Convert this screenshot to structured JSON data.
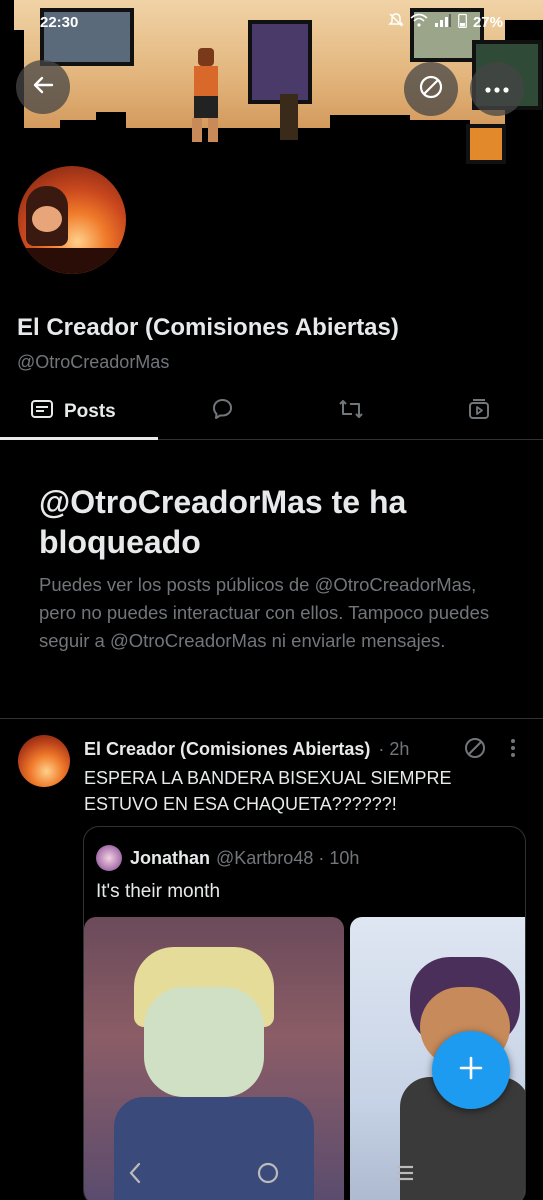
{
  "status_bar": {
    "time": "22:30",
    "battery": "27%"
  },
  "profile": {
    "display_name": "El Creador (Comisiones Abiertas)",
    "handle": "@OtroCreadorMas"
  },
  "tabs": [
    {
      "label": "Posts",
      "icon": "posts-icon",
      "active": true
    },
    {
      "label": "",
      "icon": "replies-icon"
    },
    {
      "label": "",
      "icon": "repost-icon"
    },
    {
      "label": "",
      "icon": "media-icon"
    }
  ],
  "blocked_notice": {
    "title": "@OtroCreadorMas te ha bloqueado",
    "description": "Puedes ver los posts públicos de @OtroCreadorMas, pero no puedes interactuar con ellos. Tampoco puedes seguir a @OtroCreadorMas ni enviarle mensajes."
  },
  "post": {
    "author": "El Creador (Comisiones Abiertas)",
    "time": "· 2h",
    "text": "ESPERA LA BANDERA BISEXUAL SIEMPRE ESTUVO EN ESA CHAQUETA??????!",
    "quote": {
      "name": "Jonathan",
      "handle": "@Kartbro48 · 10h",
      "text": "It's their month"
    }
  },
  "colors": {
    "accent": "#1d9bf0",
    "background": "#000000",
    "secondary_text": "#71767b"
  }
}
